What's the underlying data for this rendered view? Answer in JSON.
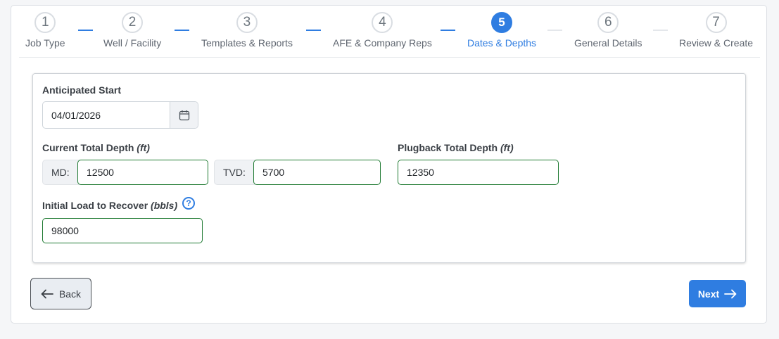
{
  "stepper": {
    "steps": [
      {
        "number": "1",
        "label": "Job Type"
      },
      {
        "number": "2",
        "label": "Well / Facility"
      },
      {
        "number": "3",
        "label": "Templates & Reports"
      },
      {
        "number": "4",
        "label": "AFE & Company Reps"
      },
      {
        "number": "5",
        "label": "Dates & Depths"
      },
      {
        "number": "6",
        "label": "General Details"
      },
      {
        "number": "7",
        "label": "Review & Create"
      }
    ],
    "active_step": 5
  },
  "form": {
    "anticipated_start": {
      "label": "Anticipated Start",
      "value": "04/01/2026"
    },
    "current_total_depth": {
      "label": "Current Total Depth",
      "unit": "(ft)",
      "md_label": "MD:",
      "md_value": "12500",
      "tvd_label": "TVD:",
      "tvd_value": "5700"
    },
    "plugback_total_depth": {
      "label": "Plugback Total Depth",
      "unit": "(ft)",
      "value": "12350"
    },
    "initial_load": {
      "label": "Initial Load to Recover",
      "unit": "(bbls)",
      "value": "98000",
      "help_icon": "?"
    }
  },
  "buttons": {
    "back_label": "Back",
    "next_label": "Next"
  },
  "colors": {
    "accent": "#2f7de1",
    "valid_border": "#1f7a32"
  }
}
